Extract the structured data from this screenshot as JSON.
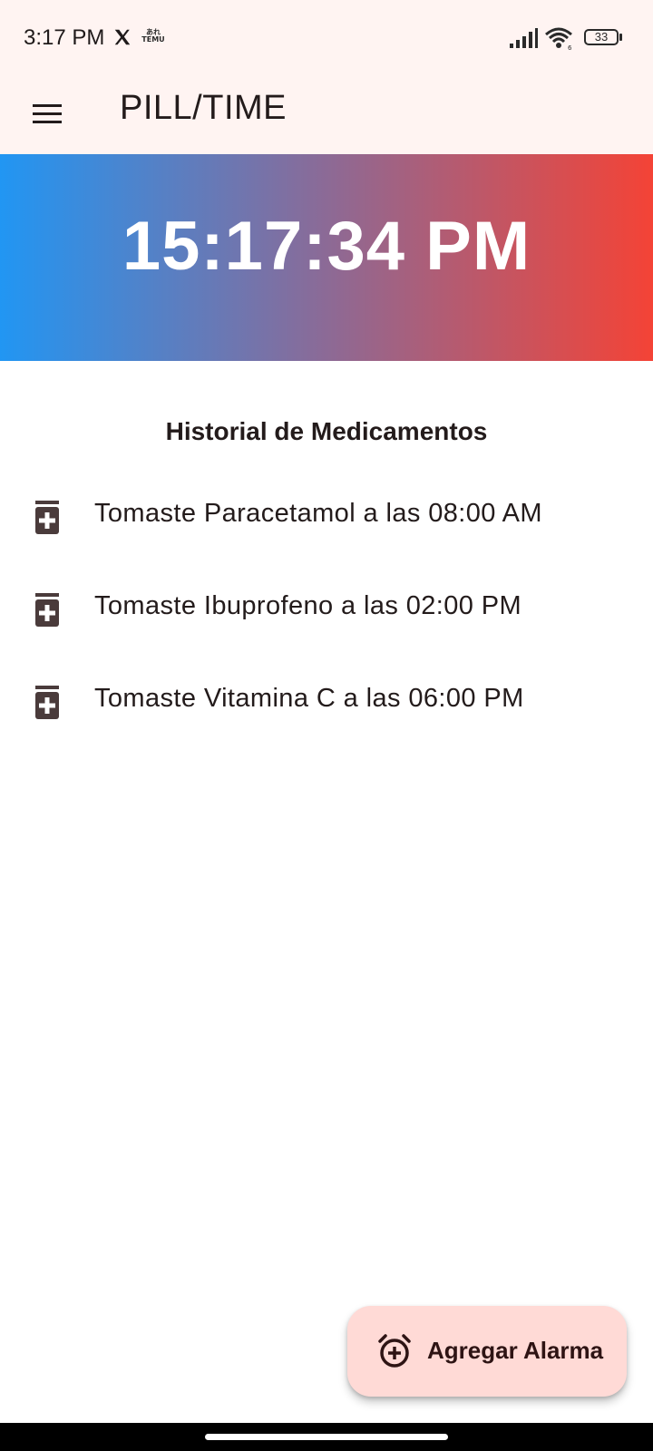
{
  "status_bar": {
    "time": "3:17 PM",
    "temu_line1": "あれ",
    "temu_line2": "TEMU",
    "battery": "33"
  },
  "app_bar": {
    "title": "PILL/TIME"
  },
  "clock": {
    "time": "15:17:34 PM",
    "gradient_start": "#2196f3",
    "gradient_end": "#f44336"
  },
  "history": {
    "title": "Historial de Medicamentos",
    "items": [
      {
        "icon": "medication-icon",
        "text": "Tomaste Paracetamol a las 08:00 AM"
      },
      {
        "icon": "medication-icon",
        "text": "Tomaste Ibuprofeno a las 02:00 PM"
      },
      {
        "icon": "medication-icon",
        "text": "Tomaste Vitamina C a las 06:00 PM"
      }
    ]
  },
  "fab": {
    "icon": "alarm-add-icon",
    "label": "Agregar Alarma",
    "background": "#ffdad6"
  }
}
